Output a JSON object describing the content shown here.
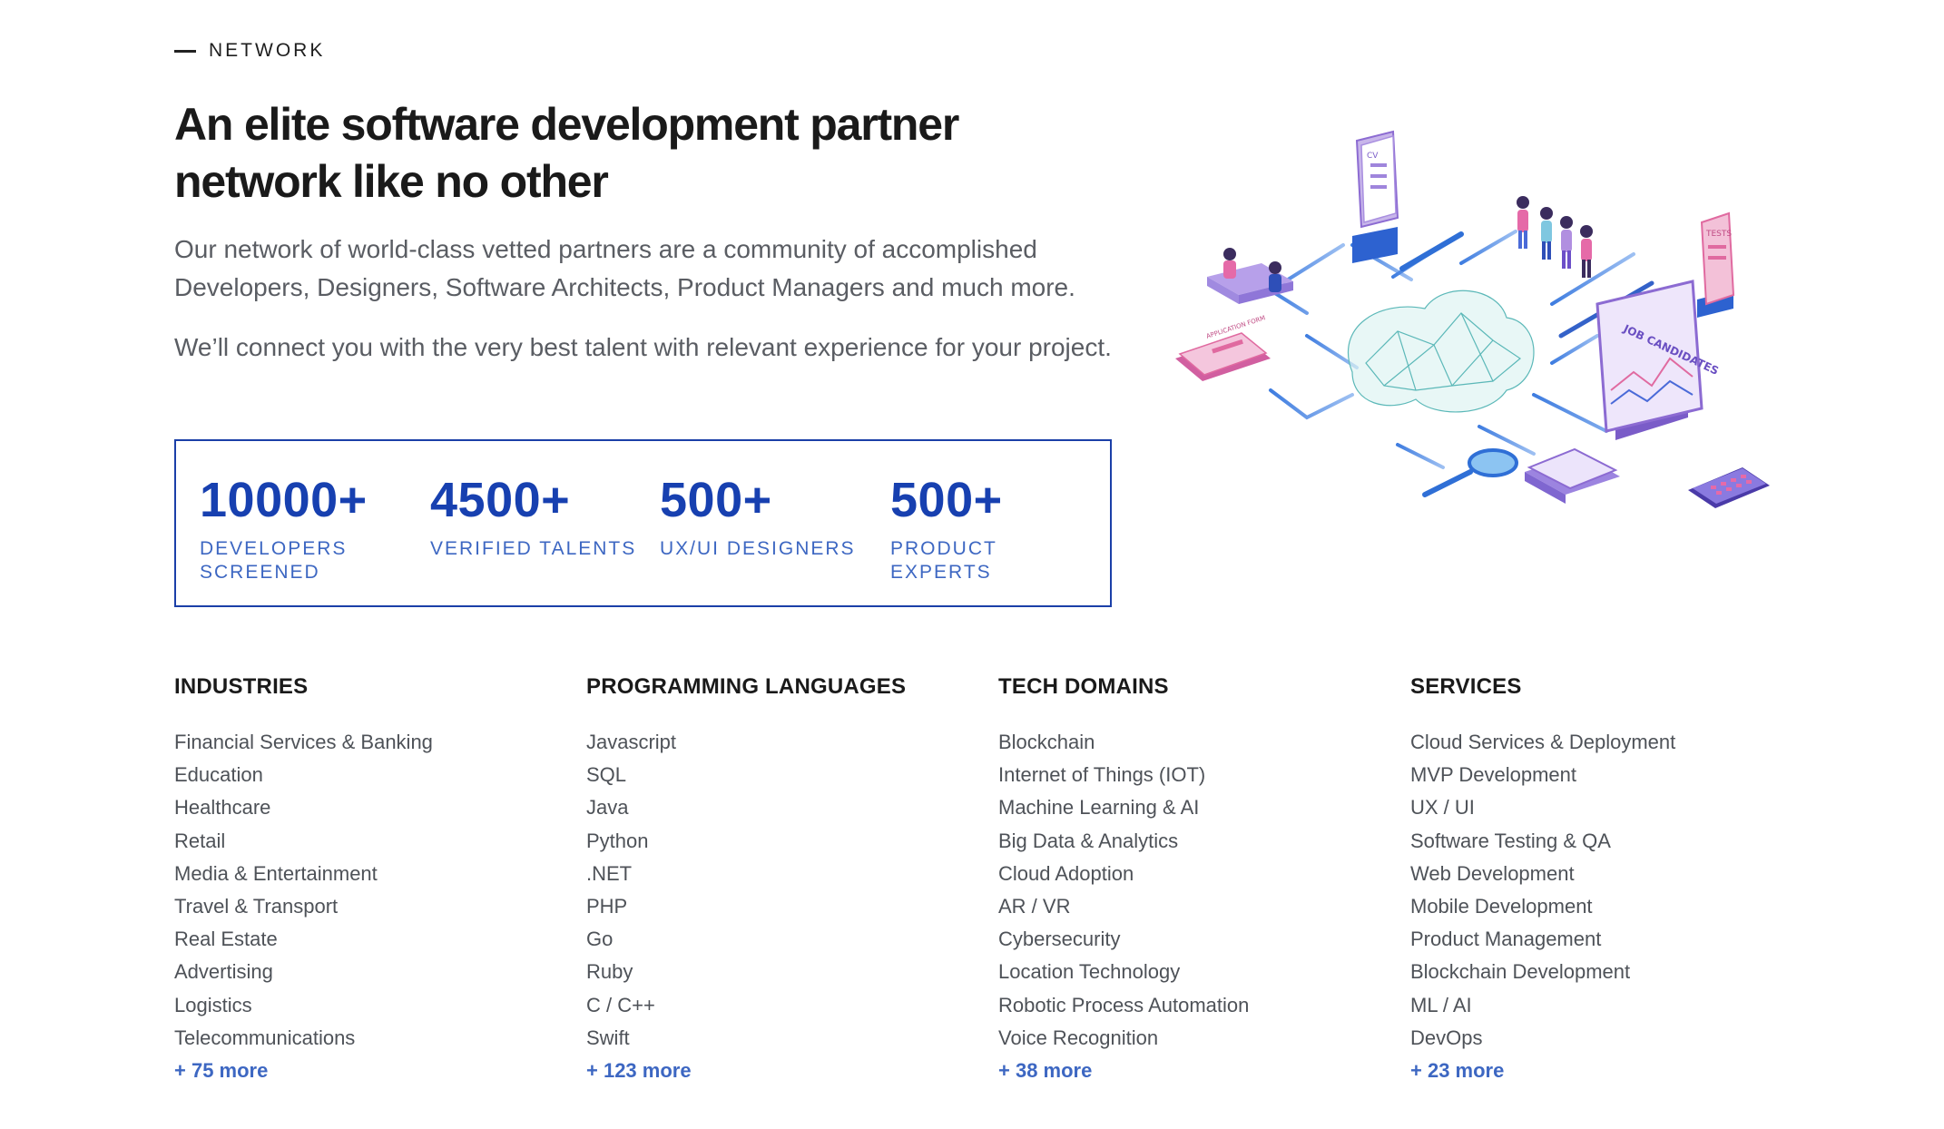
{
  "section": {
    "eyebrow": "NETWORK"
  },
  "headline": "An elite software development partner network like no other",
  "paragraphs": [
    "Our network of world-class vetted partners are a community of accomplished Developers, Designers, Software Architects, Product Managers and much more.",
    "We’ll connect you with the very best talent with relevant experience for your project."
  ],
  "stats": [
    {
      "value": "10000+",
      "label": "DEVELOPERS SCREENED"
    },
    {
      "value": "4500+",
      "label": "VERIFIED TALENTS"
    },
    {
      "value": "500+",
      "label": "UX/UI DESIGNERS"
    },
    {
      "value": "500+",
      "label": "PRODUCT EXPERTS"
    }
  ],
  "illustration": {
    "icons": [
      "cv-document-icon",
      "team-people-icon",
      "tests-document-icon",
      "meeting-desk-icon",
      "ai-brain-icon",
      "application-form-icon",
      "job-candidates-board-icon",
      "magnifier-icon",
      "calendar-icon",
      "calculator-icon"
    ],
    "labels": {
      "cv": "CV",
      "tests": "TESTS",
      "board": "JOB CANDIDATES",
      "form": "APPLICATION FORM"
    }
  },
  "categories": [
    {
      "title": "INDUSTRIES",
      "items": [
        "Financial Services & Banking",
        "Education",
        "Healthcare",
        "Retail",
        "Media & Entertainment",
        "Travel & Transport",
        "Real Estate",
        "Advertising",
        "Logistics",
        "Telecommunications"
      ],
      "more": "+ 75 more"
    },
    {
      "title": "PROGRAMMING LANGUAGES",
      "items": [
        "Javascript",
        "SQL",
        "Java",
        "Python",
        ".NET",
        "PHP",
        "Go",
        "Ruby",
        "C / C++",
        "Swift"
      ],
      "more": "+ 123 more"
    },
    {
      "title": "TECH DOMAINS",
      "items": [
        "Blockchain",
        "Internet of Things (IOT)",
        "Machine Learning & AI",
        "Big Data & Analytics",
        "Cloud Adoption",
        "AR / VR",
        "Cybersecurity",
        "Location Technology",
        "Robotic Process Automation",
        "Voice Recognition"
      ],
      "more": "+ 38 more"
    },
    {
      "title": "SERVICES",
      "items": [
        "Cloud Services & Deployment",
        "MVP Development",
        "UX / UI",
        "Software Testing & QA",
        "Web Development",
        "Mobile Development",
        "Product Management",
        "Blockchain Development",
        "ML / AI",
        "DevOps"
      ],
      "more": "+ 23 more"
    }
  ],
  "colors": {
    "accent": "#1740b0",
    "label": "#3d67c2",
    "body": "#5a5d63",
    "heading": "#1a1a1a"
  }
}
